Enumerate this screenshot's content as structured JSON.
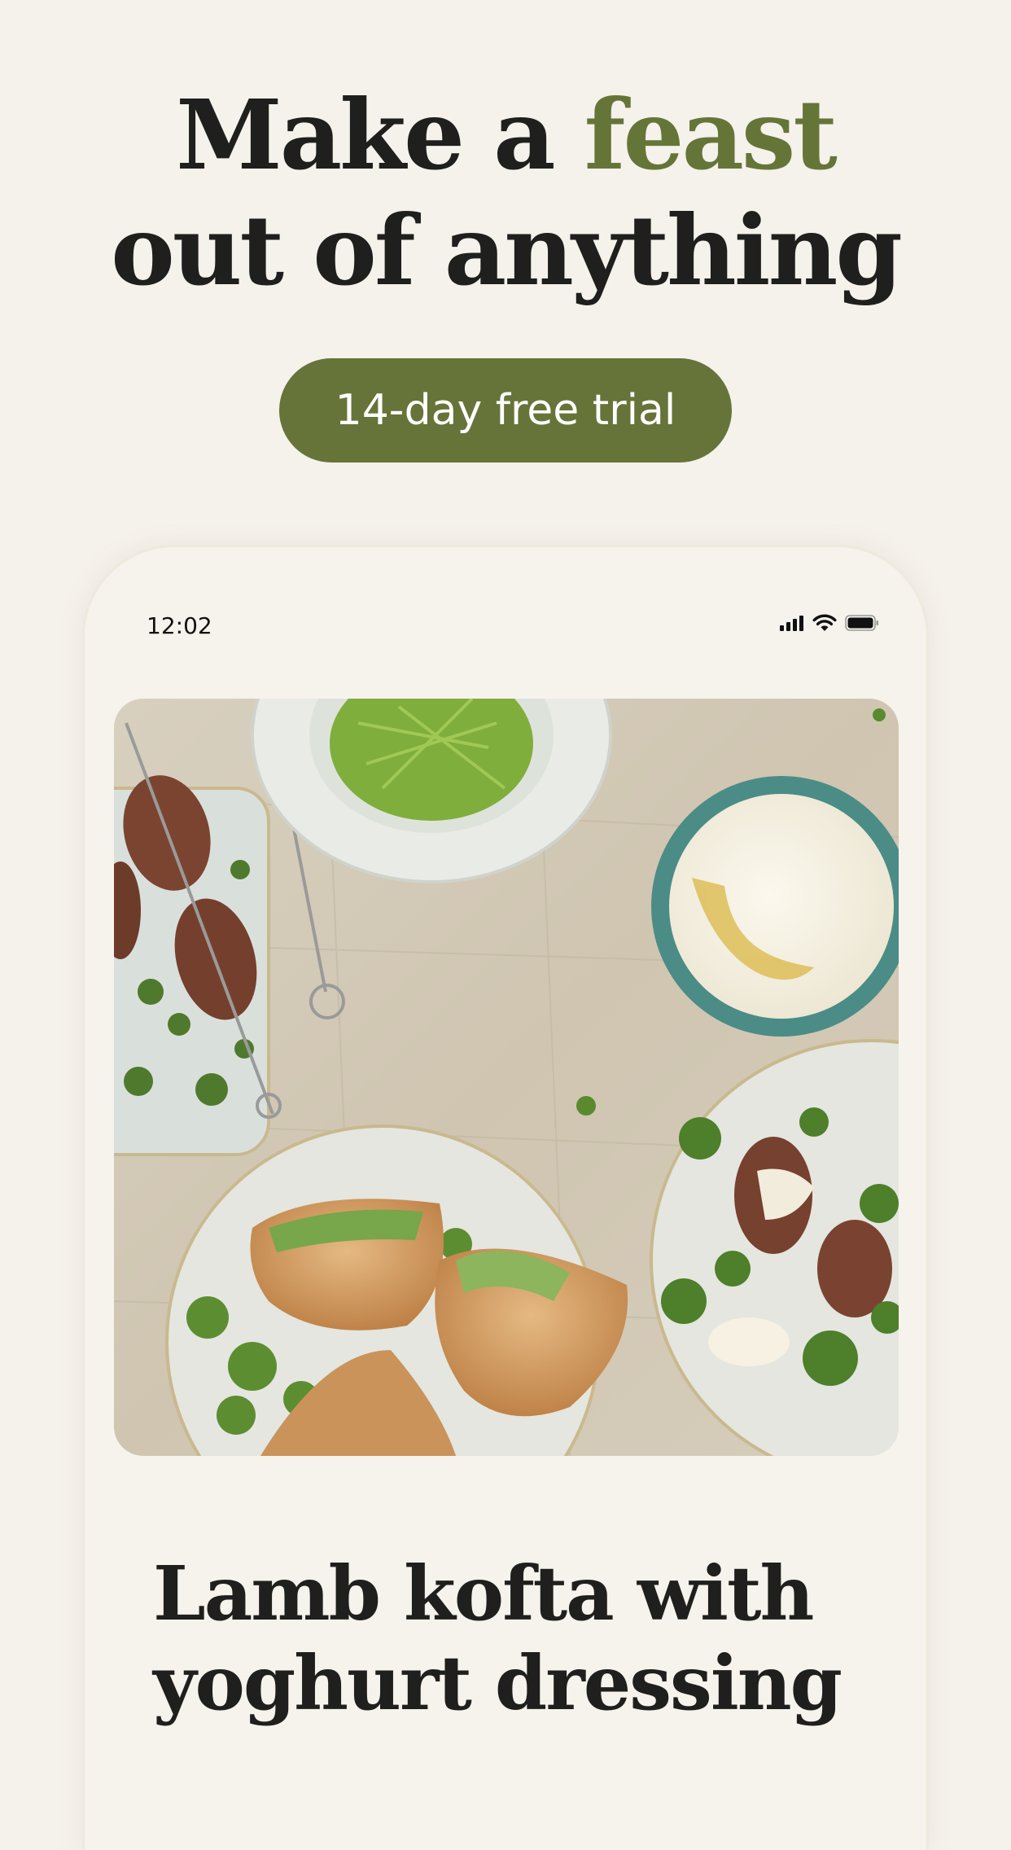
{
  "headline": {
    "part1": "Make a ",
    "accent": "feast",
    "line2": "out of anything"
  },
  "cta": {
    "label": "14-day free trial"
  },
  "phone": {
    "status_bar": {
      "time": "12:02",
      "icons": [
        "signal-icon",
        "wifi-icon",
        "battery-icon"
      ]
    },
    "recipe": {
      "title": "Lamb kofta with yoghurt dressing",
      "image": "lamb-kofta-photo"
    }
  },
  "colors": {
    "background": "#f5f1eb",
    "accent": "#657538",
    "button": "#667439",
    "text": "#1f1f1d"
  }
}
